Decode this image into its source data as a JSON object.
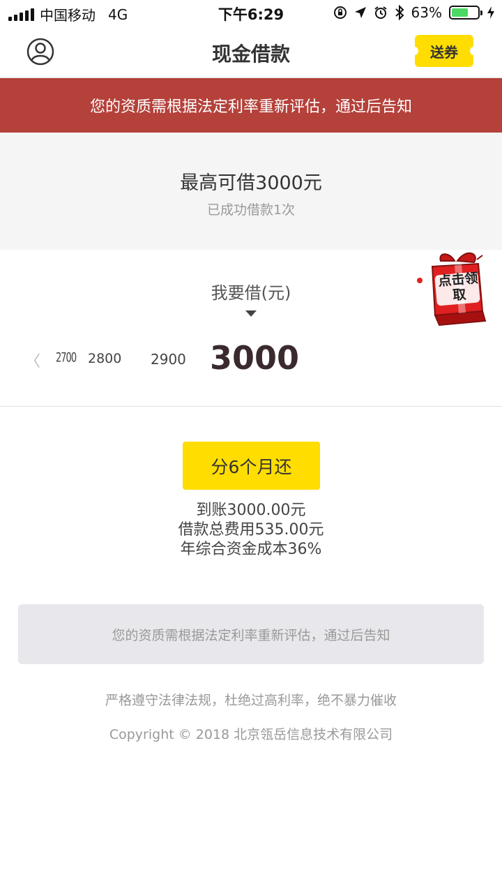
{
  "status_bar": {
    "carrier": "中国移动",
    "network": "4G",
    "time": "下午6:29",
    "battery_percent": "63%",
    "battery_level": 0.63
  },
  "nav": {
    "title": "现金借款",
    "coupon_label": "送券"
  },
  "banner": {
    "text": "您的资质需根据法定利率重新评估，通过后告知"
  },
  "info": {
    "max_amount": "最高可借3000元",
    "history": "已成功借款1次"
  },
  "selector": {
    "label": "我要借(元)",
    "amounts": [
      "2700",
      "2800",
      "2900",
      "3000"
    ],
    "selected": "3000",
    "gift_badge_text": "点击领取"
  },
  "term": {
    "button_label": "分6个月还",
    "details": [
      "到账3000.00元",
      "借款总费用535.00元",
      "年综合资金成本36%"
    ]
  },
  "notice": {
    "text": "您的资质需根据法定利率重新评估，通过后告知"
  },
  "footer": {
    "statement": "严格遵守法律法规，杜绝过高利率，绝不暴力催收",
    "copyright": "Copyright © 2018 北京瓴岳信息技术有限公司"
  },
  "colors": {
    "accent": "#ffdd00",
    "banner": "#b4413a",
    "battery": "#4cd964"
  }
}
